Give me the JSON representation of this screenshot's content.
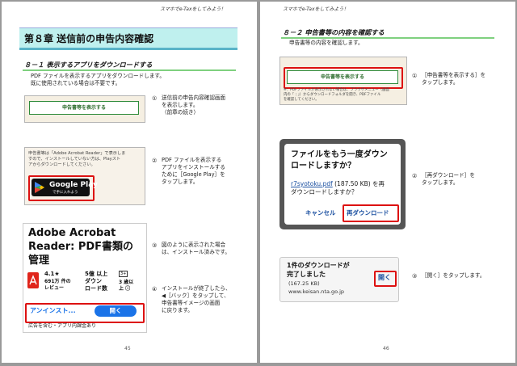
{
  "left_page": {
    "header": "スマホでe-Taxをしてみよう！",
    "chapter_title": "第８章 送信前の申告内容確認",
    "section_title": "８－１ 表示するアプリをダウンロードする",
    "intro_lines": [
      "PDF ファイルを表示するアプリをダウンロードします。",
      "既に使用されている場合は不要です。"
    ],
    "screen1": {
      "button": "申告書等を表示する"
    },
    "step1": {
      "num": "①",
      "lines": [
        "送信前の申告内容確認画面",
        "を表示します。",
        "（前章の続き）"
      ]
    },
    "screen2": {
      "lines": [
        "申告書等は「Adobe Acrobat Reader」で表示しま",
        "すので、インストールしていない方は、Playスト",
        "アからダウンロードしてください。"
      ],
      "badge_line1": "GET IT ON",
      "badge_line2": "Google Play",
      "badge_sub": "で手に入れよう"
    },
    "step2": {
      "num": "②",
      "lines": [
        "PDF ファイルを表示する",
        "アプリをインストールする",
        "ために［Google Play］を",
        "タップします。"
      ]
    },
    "screen3": {
      "title_lines": [
        "Adobe Acrobat",
        "Reader: PDF書類の",
        "管理"
      ],
      "rating": "4.1★",
      "reviews_lines": [
        "691万 件の",
        "レビュー"
      ],
      "downloads_lines": [
        "5億 以上",
        "ダウン",
        "ロード数"
      ],
      "age_badge": "3+",
      "age_lines": [
        "3 歳以",
        "上 ⓘ"
      ],
      "uninstall": "アンインスト...",
      "open": "開く",
      "ads": "広告を含む・アプリ内課金あり"
    },
    "step3": {
      "num": "③",
      "lines": [
        "図のように表示された場合",
        "は、インストール済みです。"
      ]
    },
    "step4": {
      "num": "④",
      "lines": [
        "インストールが終了したら、",
        "◀［バック］をタップして、",
        "申告書等イメージの画面",
        "に戻ります。"
      ]
    },
    "page_number": "45"
  },
  "right_page": {
    "header": "スマホでe-Taxをしてみよう！",
    "section_title": "８－２ 申告書等の内容を確認する",
    "intro": "申告書等の内容を確認します。",
    "screen1": {
      "button": "申告書等を表示する",
      "note_lines": [
        "※：PDFファイルが表示されない場合は、ブラウザメニュー（画面",
        "内の「⋮」）からダウンロードフォルダを開き、PDFファイル",
        "を確認してください。"
      ]
    },
    "step1": {
      "num": "①",
      "lines": [
        "［申告書等を表示する］を",
        "タップします。"
      ]
    },
    "dialog": {
      "title_lines": [
        "ファイルをもう一度ダウン",
        "ロードしますか？"
      ],
      "file_link": "r7syotoku.pdf",
      "file_rest": " (187.50 KB) を再",
      "line2": "ダウンロードしますか？",
      "cancel": "キャンセル",
      "redownload": "再ダウンロード"
    },
    "step2": {
      "num": "②",
      "lines": [
        "［再ダウンロード］を",
        "タップします。"
      ]
    },
    "complete": {
      "lines": [
        "1件のダウンロードが",
        "完了しました"
      ],
      "size": "(167.25 KB)",
      "site": "www.keisan.nta.go.jp",
      "open": "開く"
    },
    "step3": {
      "num": "③",
      "lines": [
        "［開く］をタップします。"
      ]
    },
    "page_number": "46"
  },
  "colors": {
    "chapter_bg": "#bff0ee",
    "section_line": "#7fd07f",
    "highlight_red": "#dd1111",
    "acrobat_red": "#e0251b",
    "open_blue": "#1a73e8"
  }
}
